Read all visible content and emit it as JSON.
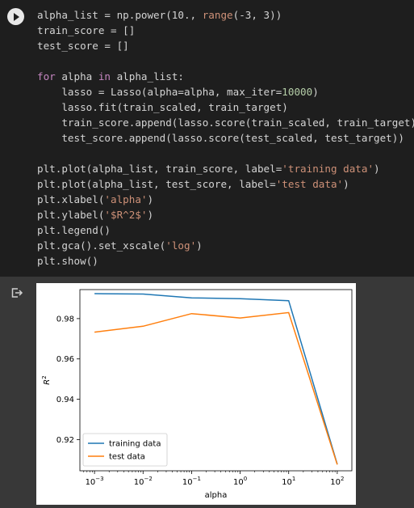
{
  "code_cell": {
    "lines": [
      [
        {
          "t": "alpha_list = np.power(10., ",
          "c": ""
        },
        {
          "t": "range",
          "c": "tok-str"
        },
        {
          "t": "(-3, 3))",
          "c": ""
        }
      ],
      [
        {
          "t": "train_score = []",
          "c": ""
        }
      ],
      [
        {
          "t": "test_score = []",
          "c": ""
        }
      ],
      [
        {
          "t": "",
          "c": ""
        }
      ],
      [
        {
          "t": "for",
          "c": "tok-kw"
        },
        {
          "t": " alpha ",
          "c": ""
        },
        {
          "t": "in",
          "c": "tok-kw"
        },
        {
          "t": " alpha_list:",
          "c": ""
        }
      ],
      [
        {
          "t": "    lasso = Lasso(alpha=alpha, max_iter=",
          "c": ""
        },
        {
          "t": "10000",
          "c": "tok-num"
        },
        {
          "t": ")",
          "c": ""
        }
      ],
      [
        {
          "t": "    lasso.fit(train_scaled, train_target)",
          "c": ""
        }
      ],
      [
        {
          "t": "    train_score.append(lasso.score(train_scaled, train_target))",
          "c": ""
        }
      ],
      [
        {
          "t": "    test_score.append(lasso.score(test_scaled, test_target))",
          "c": ""
        }
      ],
      [
        {
          "t": "",
          "c": ""
        }
      ],
      [
        {
          "t": "plt.plot(alpha_list, train_score, label=",
          "c": ""
        },
        {
          "t": "'training data'",
          "c": "tok-str"
        },
        {
          "t": ")",
          "c": ""
        }
      ],
      [
        {
          "t": "plt.plot(alpha_list, test_score, label=",
          "c": ""
        },
        {
          "t": "'test data'",
          "c": "tok-str"
        },
        {
          "t": ")",
          "c": ""
        }
      ],
      [
        {
          "t": "plt.xlabel(",
          "c": ""
        },
        {
          "t": "'alpha'",
          "c": "tok-str"
        },
        {
          "t": ")",
          "c": ""
        }
      ],
      [
        {
          "t": "plt.ylabel(",
          "c": ""
        },
        {
          "t": "'$R^2$'",
          "c": "tok-str"
        },
        {
          "t": ")",
          "c": ""
        }
      ],
      [
        {
          "t": "plt.legend()",
          "c": ""
        }
      ],
      [
        {
          "t": "plt.gca().set_xscale(",
          "c": ""
        },
        {
          "t": "'log'",
          "c": "tok-str"
        },
        {
          "t": ")",
          "c": ""
        }
      ],
      [
        {
          "t": "plt.show()",
          "c": ""
        }
      ]
    ]
  },
  "icons": {
    "run": "play-icon",
    "output": "output-redirect-icon"
  },
  "chart_data": {
    "type": "line",
    "x": [
      0.001,
      0.01,
      0.1,
      1,
      10,
      100
    ],
    "xscale": "log",
    "xlim": [
      0.0005,
      200
    ],
    "ylim": [
      0.9045,
      0.9944
    ],
    "series": [
      {
        "name": "training data",
        "color": "#1f77b4",
        "values": [
          0.9924,
          0.9922,
          0.9903,
          0.9899,
          0.9889,
          0.9078
        ]
      },
      {
        "name": "test data",
        "color": "#ff7f0e",
        "values": [
          0.9733,
          0.9762,
          0.9825,
          0.9803,
          0.983,
          0.9076
        ]
      }
    ],
    "xticks": [
      {
        "value": 0.001,
        "base": "10",
        "exp": "−3"
      },
      {
        "value": 0.01,
        "base": "10",
        "exp": "−2"
      },
      {
        "value": 0.1,
        "base": "10",
        "exp": "−1"
      },
      {
        "value": 1,
        "base": "10",
        "exp": "0"
      },
      {
        "value": 10,
        "base": "10",
        "exp": "1"
      },
      {
        "value": 100,
        "base": "10",
        "exp": "2"
      }
    ],
    "yticks": [
      {
        "value": 0.92,
        "label": "0.92"
      },
      {
        "value": 0.94,
        "label": "0.94"
      },
      {
        "value": 0.96,
        "label": "0.96"
      },
      {
        "value": 0.98,
        "label": "0.98"
      }
    ],
    "xlabel": "alpha",
    "ylabel": {
      "base": "R",
      "exp": "2"
    },
    "legend_position": "lower-left"
  }
}
